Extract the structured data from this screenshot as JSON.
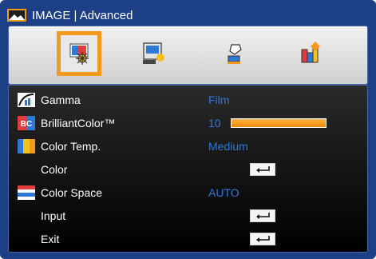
{
  "header": {
    "title": "IMAGE | Advanced"
  },
  "tabs": [
    {
      "name": "image",
      "selected": true
    },
    {
      "name": "display",
      "selected": false
    },
    {
      "name": "setup",
      "selected": false
    },
    {
      "name": "options",
      "selected": false
    }
  ],
  "menu": {
    "items": [
      {
        "label": "Gamma",
        "value": "Film"
      },
      {
        "label": "BrilliantColor™",
        "value": "10"
      },
      {
        "label": "Color Temp.",
        "value": "Medium"
      },
      {
        "label": "Color",
        "value": ""
      },
      {
        "label": "Color Space",
        "value": "AUTO"
      },
      {
        "label": "Input",
        "value": ""
      },
      {
        "label": "Exit",
        "value": ""
      }
    ]
  },
  "colors": {
    "background": "#1c3f86",
    "accent": "#f39a1e",
    "value_text": "#2f79d6"
  }
}
